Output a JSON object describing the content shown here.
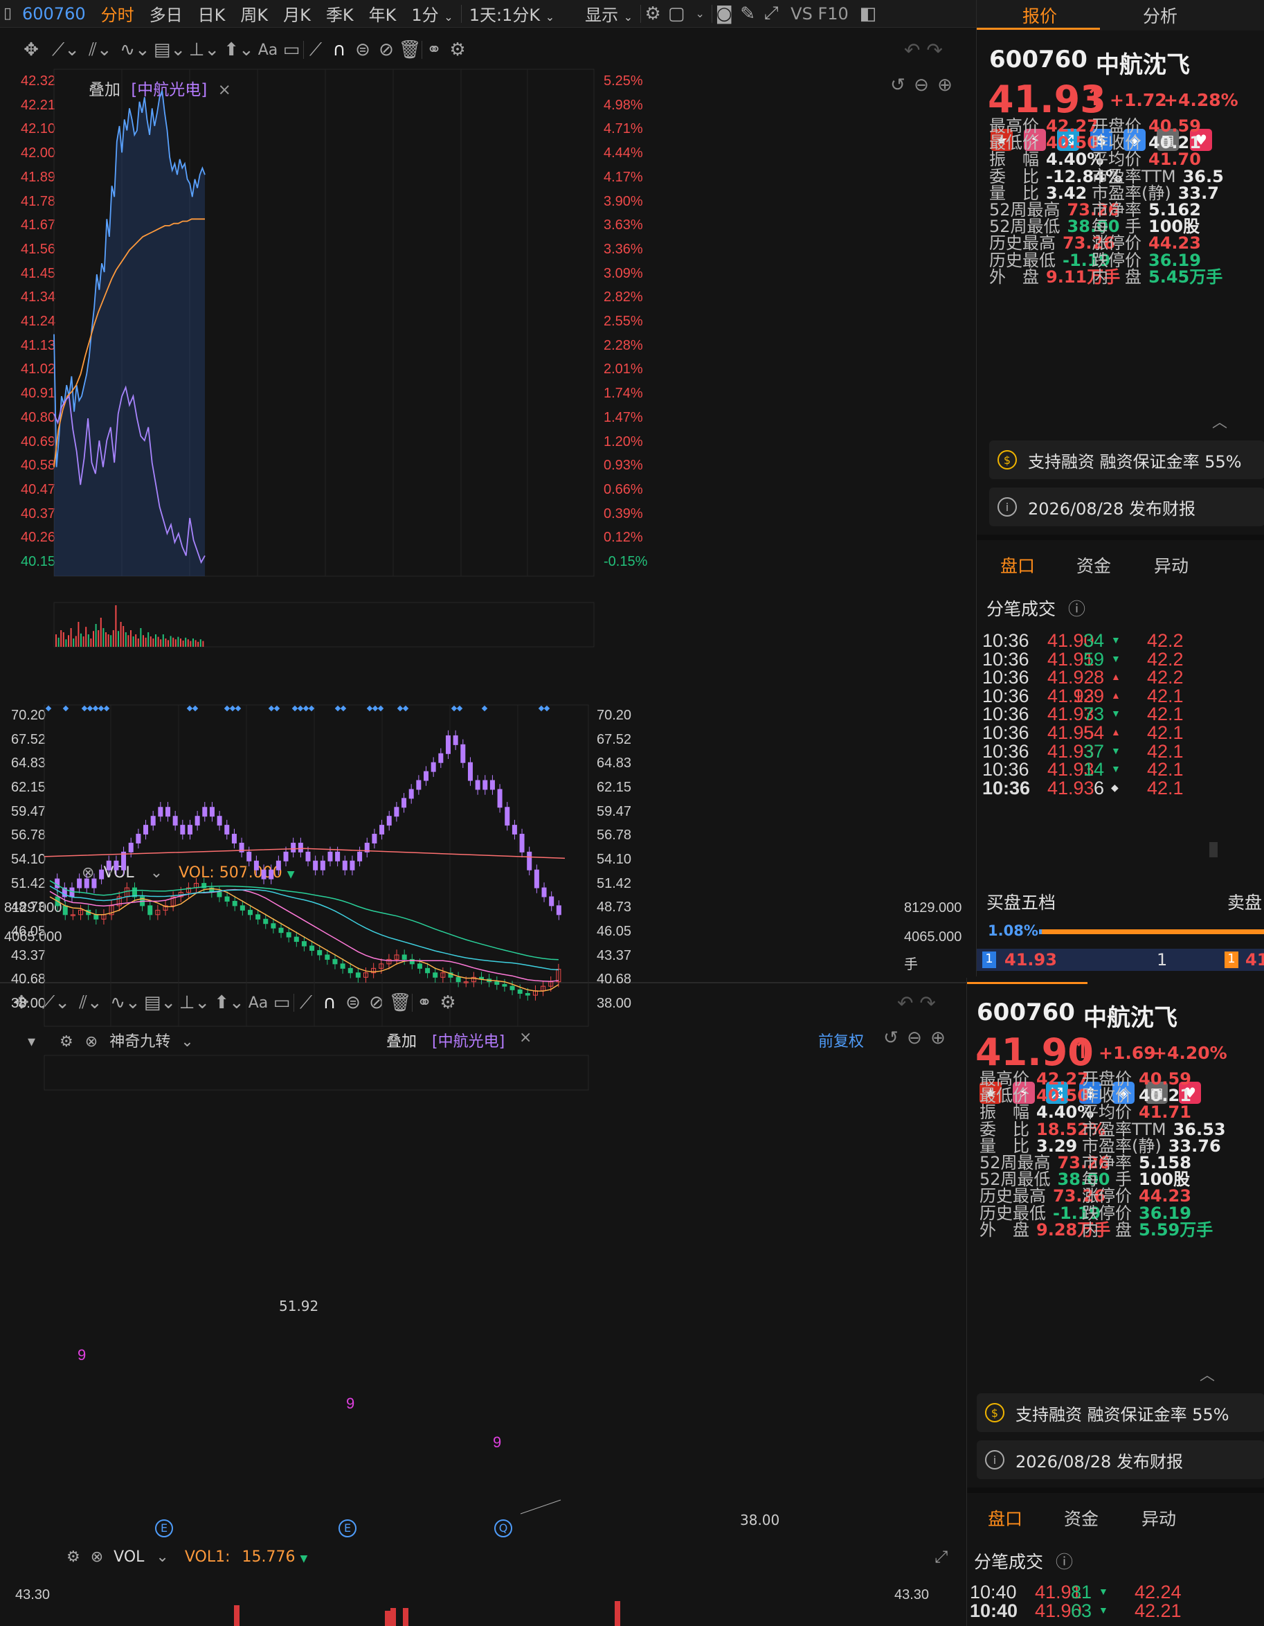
{
  "top_toolbar": {
    "code": "600760",
    "tabs": [
      "分时",
      "多日",
      "日K",
      "周K",
      "月K",
      "季K",
      "年K"
    ],
    "active_tab": "分时",
    "period": "1分",
    "range": "1天:1分K",
    "display": "显示",
    "vs": "VS F10"
  },
  "upper_chart": {
    "overlay_label": "叠加",
    "overlay_stock": "[中航光电]",
    "y_left": [
      "42.32",
      "42.21",
      "42.10",
      "42.00",
      "41.89",
      "41.78",
      "41.67",
      "41.56",
      "41.45",
      "41.34",
      "41.24",
      "41.13",
      "41.02",
      "40.91",
      "40.80",
      "40.69",
      "40.58",
      "40.47",
      "40.37",
      "40.26",
      "40.15"
    ],
    "y_right": [
      "5.25%",
      "4.98%",
      "4.71%",
      "4.44%",
      "4.17%",
      "3.90%",
      "3.63%",
      "3.36%",
      "3.09%",
      "2.82%",
      "2.55%",
      "2.28%",
      "2.01%",
      "1.74%",
      "1.47%",
      "1.20%",
      "0.93%",
      "0.66%",
      "0.39%",
      "0.12%",
      "-0.15%"
    ],
    "vol_label": "VOL",
    "vol_value": "VOL: 507.000",
    "vol_ticks": [
      "8129.000",
      "4065.000"
    ],
    "vol_unit": "手",
    "chart_data": {
      "type": "line",
      "ylim": [
        40.15,
        42.32
      ],
      "series": [
        {
          "name": "600760",
          "color": "#5aa2ff",
          "values": [
            41.18,
            40.58,
            40.72,
            40.9,
            40.86,
            40.95,
            40.9,
            40.99,
            40.83,
            40.95,
            40.88,
            40.9,
            40.95,
            41.0,
            41.08,
            41.2,
            41.3,
            41.45,
            41.38,
            41.5,
            41.46,
            41.7,
            41.62,
            41.85,
            41.8,
            42.05,
            42.12,
            42.0,
            42.15,
            42.1,
            42.2,
            42.15,
            42.08,
            42.1,
            42.23,
            42.18,
            42.25,
            42.15,
            42.08,
            42.2,
            42.12,
            42.18,
            42.25,
            42.28,
            42.18,
            42.1,
            41.98,
            41.92,
            41.95,
            41.9,
            41.97,
            41.93,
            41.95,
            41.88,
            41.86,
            41.8,
            41.88,
            41.84,
            41.9,
            41.93,
            41.9
          ]
        },
        {
          "name": "均价",
          "color": "#ff9a3c",
          "values": [
            40.58,
            40.75,
            40.84,
            40.9,
            40.92,
            40.95,
            41.0,
            41.08,
            41.15,
            41.22,
            41.28,
            41.33,
            41.38,
            41.43,
            41.47,
            41.5,
            41.53,
            41.56,
            41.58,
            41.6,
            41.62,
            41.63,
            41.64,
            41.65,
            41.66,
            41.67,
            41.67,
            41.68,
            41.68,
            41.69,
            41.69,
            41.7,
            41.7,
            41.7,
            41.7
          ]
        },
        {
          "name": "中航光电",
          "color": "#a985ff",
          "values": [
            40.82,
            40.78,
            40.85,
            40.88,
            40.9,
            40.75,
            40.65,
            40.5,
            40.62,
            40.8,
            40.6,
            40.55,
            40.7,
            40.58,
            40.7,
            40.76,
            40.6,
            40.82,
            40.9,
            40.94,
            40.86,
            40.9,
            40.8,
            40.72,
            40.7,
            40.76,
            40.6,
            40.5,
            40.4,
            40.34,
            40.28,
            40.32,
            40.24,
            40.28,
            40.22,
            40.18,
            40.35,
            40.25,
            40.2,
            40.15,
            40.18
          ]
        }
      ]
    }
  },
  "lower_chart": {
    "indicator": "神奇九转",
    "overlay_label": "叠加",
    "overlay_stock": "[中航光电]",
    "adjust": "前复权",
    "y_ticks": [
      "70.20",
      "67.52",
      "64.83",
      "62.15",
      "59.47",
      "56.78",
      "54.10",
      "51.42",
      "48.73",
      "46.05",
      "43.37",
      "40.68",
      "38.00"
    ],
    "label_high": "51.92",
    "label_low": "38.00",
    "markers": [
      "E",
      "E",
      "Q"
    ],
    "vol_label": "VOL",
    "vol_value": "VOL1:",
    "vol_num": "15.776",
    "vol_tick": "43.30",
    "chart_data": {
      "type": "candlestick",
      "ylim": [
        38.0,
        70.2
      ],
      "series": [
        {
          "name": "中航光电",
          "color": "#b67cff",
          "close": [
            52,
            51,
            50,
            51,
            52,
            51,
            52,
            53,
            54,
            53,
            55,
            56,
            57,
            58,
            59,
            60,
            59,
            58,
            57,
            58,
            59,
            60,
            59,
            58,
            57,
            56,
            55,
            54,
            53,
            52,
            53,
            54,
            55,
            56,
            55,
            54,
            53,
            54,
            55,
            54,
            53,
            54,
            55,
            56,
            57,
            58,
            59,
            60,
            61,
            62,
            63,
            64,
            65,
            66,
            68,
            67,
            65,
            63,
            62,
            63,
            62,
            60,
            58,
            57,
            55,
            53,
            51,
            50,
            49,
            48
          ]
        },
        {
          "name": "600760",
          "color": "#f04a4a",
          "close": [
            50,
            49,
            48,
            48,
            48.5,
            48,
            47.5,
            48,
            49,
            50,
            51,
            50,
            49,
            48,
            48.5,
            49,
            50,
            50.5,
            51,
            51.5,
            51,
            50.5,
            50,
            49.5,
            49,
            48.5,
            48,
            47.5,
            47,
            46.5,
            46,
            45.5,
            45,
            44.5,
            44,
            43.5,
            43,
            42.5,
            42,
            41.5,
            41,
            41.5,
            42,
            42.5,
            43,
            43.5,
            43,
            42.5,
            42,
            41.5,
            41,
            41.5,
            41,
            40.5,
            40.5,
            41,
            40.8,
            40.5,
            40.2,
            40,
            39.6,
            39.2,
            39,
            39.5,
            40,
            40.5,
            41.9
          ]
        }
      ]
    }
  },
  "quote_top": {
    "code": "600760",
    "name": "中航沈飞",
    "price": "41.93",
    "change": "+1.72",
    "pct": "+4.28%",
    "tabs": [
      "报价",
      "分析"
    ],
    "fields": [
      [
        "最高价",
        "42.27",
        "red"
      ],
      [
        "开盘价",
        "40.59",
        "red"
      ],
      [
        "最低价",
        "40.50",
        "red"
      ],
      [
        "昨收价",
        "40.21",
        "wht"
      ],
      [
        "振　幅",
        "4.40%",
        "wht"
      ],
      [
        "平均价",
        "41.70",
        "red"
      ],
      [
        "委　比",
        "-12.84%",
        "wht"
      ],
      [
        "市盈率TTM",
        "36.5",
        "wht"
      ],
      [
        "量　比",
        "3.42",
        "wht"
      ],
      [
        "市盈率(静)",
        "33.7",
        "wht"
      ],
      [
        "52周最高",
        "73.26",
        "red"
      ],
      [
        "市净率",
        "5.162",
        "wht"
      ],
      [
        "52周最低",
        "38.00",
        "grn"
      ],
      [
        "每　手",
        "100股",
        "wht"
      ],
      [
        "历史最高",
        "73.26",
        "red"
      ],
      [
        "涨停价",
        "44.23",
        "red"
      ],
      [
        "历史最低",
        "-1.19",
        "grn"
      ],
      [
        "跌停价",
        "36.19",
        "grn"
      ],
      [
        "外　盘",
        "9.11万手",
        "red"
      ],
      [
        "内　盘",
        "5.45万手",
        "grn"
      ]
    ],
    "margin_info": "支持融资 融资保证金率 55%",
    "report_info": "2026/08/28  发布财报",
    "subtabs": [
      "盘口",
      "资金",
      "异动"
    ],
    "ticks_title": "分笔成交",
    "ticks": [
      [
        "10:36",
        "41.90",
        "34",
        "down",
        "42.2"
      ],
      [
        "10:36",
        "41.91",
        "59",
        "down",
        "42.2"
      ],
      [
        "10:36",
        "41.92",
        "8",
        "up",
        "42.2"
      ],
      [
        "10:36",
        "41.93",
        "129",
        "up",
        "42.1"
      ],
      [
        "10:36",
        "41.93",
        "73",
        "down",
        "42.1"
      ],
      [
        "10:36",
        "41.95",
        "54",
        "up",
        "42.1"
      ],
      [
        "10:36",
        "41.93",
        "37",
        "down",
        "42.1"
      ],
      [
        "10:36",
        "41.93",
        "14",
        "down",
        "42.1"
      ],
      [
        "10:36",
        "41.93",
        "6",
        "flat",
        "42.1"
      ]
    ],
    "book_left": "买盘五档",
    "book_right": "卖盘",
    "book_pct": "1.08%",
    "bid_idx": "1",
    "bid_price": "41.93",
    "bid_qty": "1",
    "ask_idx": "1",
    "ask_price": "41"
  },
  "quote_bottom": {
    "code": "600760",
    "name": "中航沈飞",
    "price": "41.90",
    "change": "+1.69",
    "pct": "+4.20%",
    "fields": [
      [
        "最高价",
        "42.27",
        "red"
      ],
      [
        "开盘价",
        "40.59",
        "red"
      ],
      [
        "最低价",
        "40.50",
        "red"
      ],
      [
        "昨收价",
        "40.21",
        "wht"
      ],
      [
        "振　幅",
        "4.40%",
        "wht"
      ],
      [
        "平均价",
        "41.71",
        "red"
      ],
      [
        "委　比",
        "18.52%",
        "red"
      ],
      [
        "市盈率TTM",
        "36.53",
        "wht"
      ],
      [
        "量　比",
        "3.29",
        "wht"
      ],
      [
        "市盈率(静)",
        "33.76",
        "wht"
      ],
      [
        "52周最高",
        "73.26",
        "red"
      ],
      [
        "市净率",
        "5.158",
        "wht"
      ],
      [
        "52周最低",
        "38.00",
        "grn"
      ],
      [
        "每　手",
        "100股",
        "wht"
      ],
      [
        "历史最高",
        "73.26",
        "red"
      ],
      [
        "涨停价",
        "44.23",
        "red"
      ],
      [
        "历史最低",
        "-1.19",
        "grn"
      ],
      [
        "跌停价",
        "36.19",
        "grn"
      ],
      [
        "外　盘",
        "9.28万手",
        "red"
      ],
      [
        "内　盘",
        "5.59万手",
        "grn"
      ]
    ],
    "margin_info": "支持融资 融资保证金率 55%",
    "report_info": "2026/08/28  发布财报",
    "subtabs": [
      "盘口",
      "资金",
      "异动"
    ],
    "ticks_title": "分笔成交",
    "ticks": [
      [
        "10:40",
        "41.91",
        "81",
        "down",
        "42.24"
      ],
      [
        "10:40",
        "41.90",
        "63",
        "down",
        "42.21"
      ]
    ]
  },
  "colors": {
    "up": "#f04a4a",
    "down": "#22c07a",
    "accent": "#ff8c1a",
    "link": "#4f9cf9",
    "overlay": "#b67cff"
  }
}
